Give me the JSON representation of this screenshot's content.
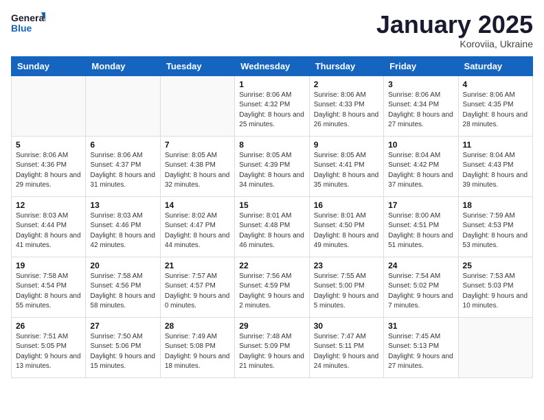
{
  "logo": {
    "line1": "General",
    "line2": "Blue"
  },
  "title": "January 2025",
  "subtitle": "Koroviia, Ukraine",
  "weekdays": [
    "Sunday",
    "Monday",
    "Tuesday",
    "Wednesday",
    "Thursday",
    "Friday",
    "Saturday"
  ],
  "weeks": [
    [
      {
        "day": "",
        "info": ""
      },
      {
        "day": "",
        "info": ""
      },
      {
        "day": "",
        "info": ""
      },
      {
        "day": "1",
        "info": "Sunrise: 8:06 AM\nSunset: 4:32 PM\nDaylight: 8 hours and 25 minutes."
      },
      {
        "day": "2",
        "info": "Sunrise: 8:06 AM\nSunset: 4:33 PM\nDaylight: 8 hours and 26 minutes."
      },
      {
        "day": "3",
        "info": "Sunrise: 8:06 AM\nSunset: 4:34 PM\nDaylight: 8 hours and 27 minutes."
      },
      {
        "day": "4",
        "info": "Sunrise: 8:06 AM\nSunset: 4:35 PM\nDaylight: 8 hours and 28 minutes."
      }
    ],
    [
      {
        "day": "5",
        "info": "Sunrise: 8:06 AM\nSunset: 4:36 PM\nDaylight: 8 hours and 29 minutes."
      },
      {
        "day": "6",
        "info": "Sunrise: 8:06 AM\nSunset: 4:37 PM\nDaylight: 8 hours and 31 minutes."
      },
      {
        "day": "7",
        "info": "Sunrise: 8:05 AM\nSunset: 4:38 PM\nDaylight: 8 hours and 32 minutes."
      },
      {
        "day": "8",
        "info": "Sunrise: 8:05 AM\nSunset: 4:39 PM\nDaylight: 8 hours and 34 minutes."
      },
      {
        "day": "9",
        "info": "Sunrise: 8:05 AM\nSunset: 4:41 PM\nDaylight: 8 hours and 35 minutes."
      },
      {
        "day": "10",
        "info": "Sunrise: 8:04 AM\nSunset: 4:42 PM\nDaylight: 8 hours and 37 minutes."
      },
      {
        "day": "11",
        "info": "Sunrise: 8:04 AM\nSunset: 4:43 PM\nDaylight: 8 hours and 39 minutes."
      }
    ],
    [
      {
        "day": "12",
        "info": "Sunrise: 8:03 AM\nSunset: 4:44 PM\nDaylight: 8 hours and 41 minutes."
      },
      {
        "day": "13",
        "info": "Sunrise: 8:03 AM\nSunset: 4:46 PM\nDaylight: 8 hours and 42 minutes."
      },
      {
        "day": "14",
        "info": "Sunrise: 8:02 AM\nSunset: 4:47 PM\nDaylight: 8 hours and 44 minutes."
      },
      {
        "day": "15",
        "info": "Sunrise: 8:01 AM\nSunset: 4:48 PM\nDaylight: 8 hours and 46 minutes."
      },
      {
        "day": "16",
        "info": "Sunrise: 8:01 AM\nSunset: 4:50 PM\nDaylight: 8 hours and 49 minutes."
      },
      {
        "day": "17",
        "info": "Sunrise: 8:00 AM\nSunset: 4:51 PM\nDaylight: 8 hours and 51 minutes."
      },
      {
        "day": "18",
        "info": "Sunrise: 7:59 AM\nSunset: 4:53 PM\nDaylight: 8 hours and 53 minutes."
      }
    ],
    [
      {
        "day": "19",
        "info": "Sunrise: 7:58 AM\nSunset: 4:54 PM\nDaylight: 8 hours and 55 minutes."
      },
      {
        "day": "20",
        "info": "Sunrise: 7:58 AM\nSunset: 4:56 PM\nDaylight: 8 hours and 58 minutes."
      },
      {
        "day": "21",
        "info": "Sunrise: 7:57 AM\nSunset: 4:57 PM\nDaylight: 9 hours and 0 minutes."
      },
      {
        "day": "22",
        "info": "Sunrise: 7:56 AM\nSunset: 4:59 PM\nDaylight: 9 hours and 2 minutes."
      },
      {
        "day": "23",
        "info": "Sunrise: 7:55 AM\nSunset: 5:00 PM\nDaylight: 9 hours and 5 minutes."
      },
      {
        "day": "24",
        "info": "Sunrise: 7:54 AM\nSunset: 5:02 PM\nDaylight: 9 hours and 7 minutes."
      },
      {
        "day": "25",
        "info": "Sunrise: 7:53 AM\nSunset: 5:03 PM\nDaylight: 9 hours and 10 minutes."
      }
    ],
    [
      {
        "day": "26",
        "info": "Sunrise: 7:51 AM\nSunset: 5:05 PM\nDaylight: 9 hours and 13 minutes."
      },
      {
        "day": "27",
        "info": "Sunrise: 7:50 AM\nSunset: 5:06 PM\nDaylight: 9 hours and 15 minutes."
      },
      {
        "day": "28",
        "info": "Sunrise: 7:49 AM\nSunset: 5:08 PM\nDaylight: 9 hours and 18 minutes."
      },
      {
        "day": "29",
        "info": "Sunrise: 7:48 AM\nSunset: 5:09 PM\nDaylight: 9 hours and 21 minutes."
      },
      {
        "day": "30",
        "info": "Sunrise: 7:47 AM\nSunset: 5:11 PM\nDaylight: 9 hours and 24 minutes."
      },
      {
        "day": "31",
        "info": "Sunrise: 7:45 AM\nSunset: 5:13 PM\nDaylight: 9 hours and 27 minutes."
      },
      {
        "day": "",
        "info": ""
      }
    ]
  ]
}
